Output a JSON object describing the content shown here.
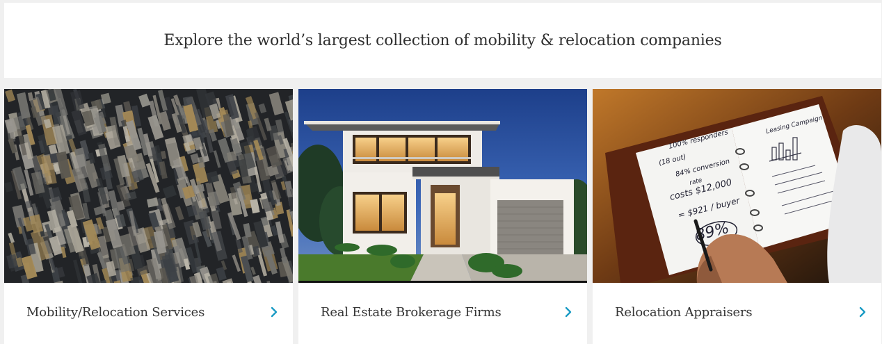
{
  "hero": {
    "title": "Explore the world’s largest collection of mobility & relocation companies"
  },
  "cards": [
    {
      "label": "Mobility/Relocation Services",
      "image": "aerial-city-skyscrapers",
      "icon": "chevron-right-icon"
    },
    {
      "label": "Real Estate Brokerage Firms",
      "image": "modern-house-exterior",
      "icon": "chevron-right-icon"
    },
    {
      "label": "Relocation Appraisers",
      "image": "notebook-handwritten-calculations",
      "icon": "chevron-right-icon"
    }
  ],
  "notebook_text": {
    "left": [
      "100% responders",
      "(18 out)",
      "84% conversion",
      "rate",
      "costs $12,000",
      "= $921 / buyer",
      "89%"
    ],
    "right": [
      "Leasing Campaign"
    ]
  },
  "colors": {
    "accent": "#1a9bc4",
    "background": "#f0f0f0",
    "card": "#ffffff",
    "text": "#353535"
  }
}
